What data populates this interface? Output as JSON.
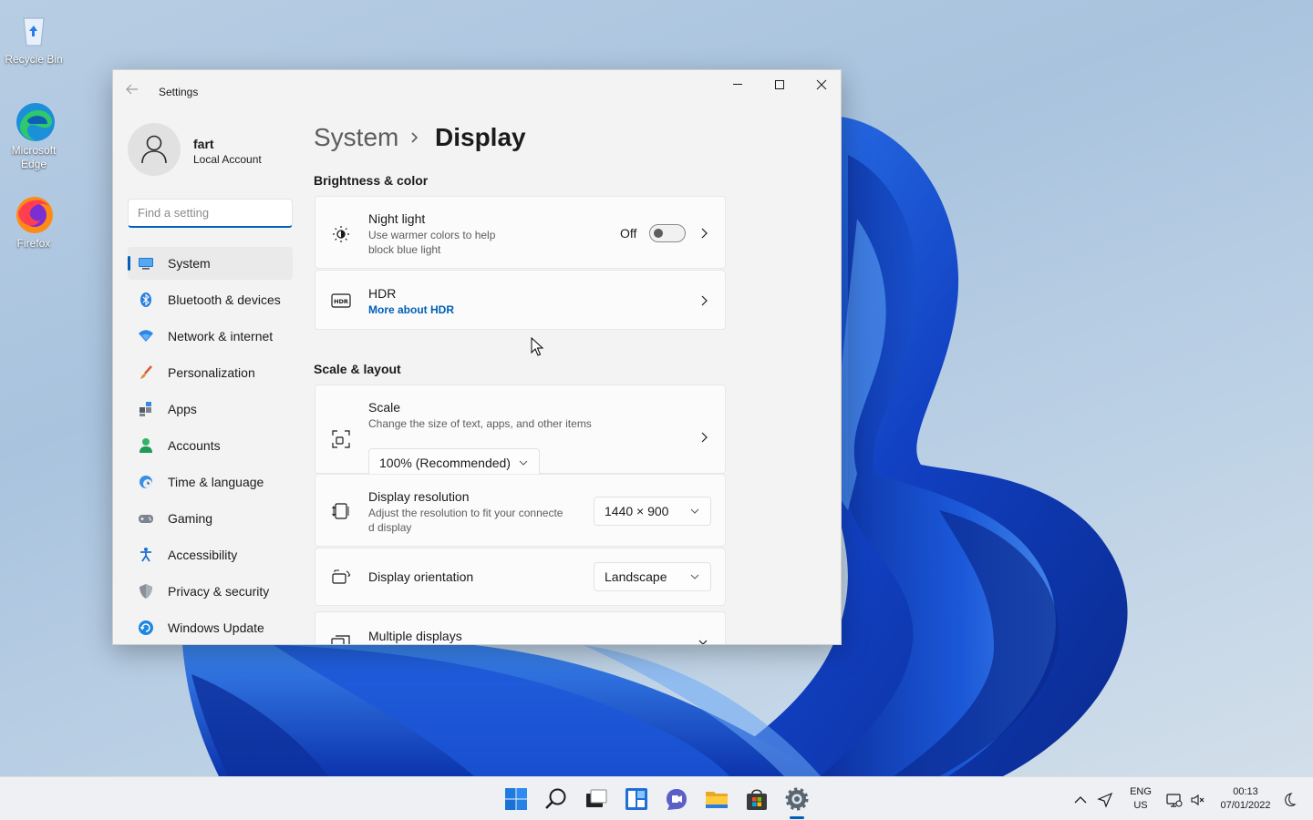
{
  "desktop": {
    "icons": [
      {
        "label": "Recycle Bin",
        "icon": "recycle-bin-icon"
      },
      {
        "label": "Microsoft Edge",
        "icon": "edge-icon"
      },
      {
        "label": "Firefox",
        "icon": "firefox-icon"
      }
    ]
  },
  "window": {
    "title": "Settings",
    "controls": [
      "minimize-icon",
      "maximize-icon",
      "close-icon"
    ]
  },
  "profile": {
    "name": "fart",
    "account_type": "Local Account"
  },
  "search": {
    "placeholder": "Find a setting"
  },
  "nav": {
    "items": [
      {
        "label": "System",
        "icon": "system-monitor-icon",
        "active": true
      },
      {
        "label": "Bluetooth & devices",
        "icon": "bluetooth-icon"
      },
      {
        "label": "Network & internet",
        "icon": "wifi-icon"
      },
      {
        "label": "Personalization",
        "icon": "brush-icon"
      },
      {
        "label": "Apps",
        "icon": "apps-icon"
      },
      {
        "label": "Accounts",
        "icon": "account-icon"
      },
      {
        "label": "Time & language",
        "icon": "globe-clock-icon"
      },
      {
        "label": "Gaming",
        "icon": "gamepad-icon"
      },
      {
        "label": "Accessibility",
        "icon": "accessibility-icon"
      },
      {
        "label": "Privacy & security",
        "icon": "shield-icon"
      },
      {
        "label": "Windows Update",
        "icon": "update-icon"
      }
    ]
  },
  "breadcrumb": {
    "parent": "System",
    "current": "Display"
  },
  "brightness_section": {
    "title": "Brightness & color",
    "night_light": {
      "title": "Night light",
      "desc_line1": "Use warmer colors to help",
      "desc_line2": "block blue light",
      "state": "Off",
      "enabled": false
    },
    "hdr": {
      "title": "HDR",
      "link": "More about HDR"
    }
  },
  "scale_section": {
    "title": "Scale & layout",
    "scale": {
      "title": "Scale",
      "desc": "Change the size of text, apps, and other items",
      "value": "100% (Recommended)"
    },
    "resolution": {
      "title": "Display resolution",
      "desc_line1": "Adjust the resolution to fit your connecte",
      "desc_line2": "d display",
      "value": "1440 × 900"
    },
    "orientation": {
      "title": "Display orientation",
      "value": "Landscape"
    },
    "multiple": {
      "title": "Multiple displays"
    }
  },
  "taskbar": {
    "apps": [
      "start-icon",
      "search-icon",
      "task-view-icon",
      "widgets-icon",
      "chat-icon",
      "file-explorer-icon",
      "store-icon",
      "settings-icon"
    ],
    "lang_line1": "ENG",
    "lang_line2": "US",
    "time": "00:13",
    "date": "07/01/2022"
  },
  "colors": {
    "accent": "#005fb8",
    "window_bg": "#f3f3f3",
    "card_bg": "#fbfbfb",
    "wallpaper_blue": "#1746c9"
  }
}
